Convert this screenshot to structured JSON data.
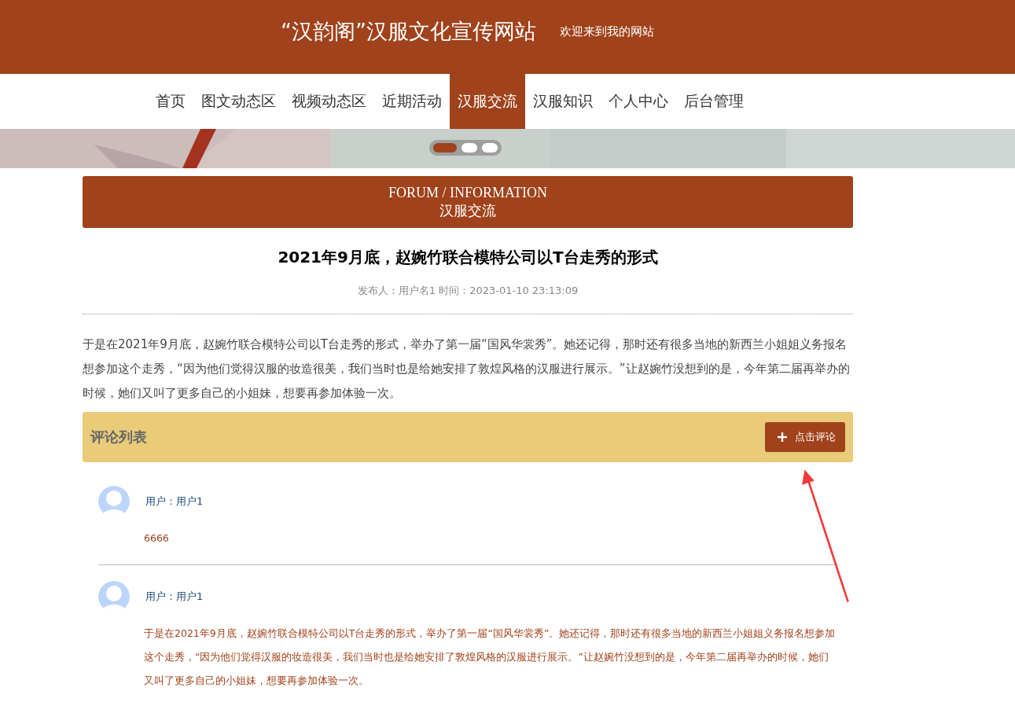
{
  "header": {
    "site_title": "“汉韵阁”汉服文化宣传网站",
    "welcome": "欢迎来到我的网站"
  },
  "nav": [
    {
      "label": "首页",
      "selected": false
    },
    {
      "label": "图文动态区",
      "selected": false
    },
    {
      "label": "视频动态区",
      "selected": false
    },
    {
      "label": "近期活动",
      "selected": false
    },
    {
      "label": "汉服交流",
      "selected": true
    },
    {
      "label": "汉服知识",
      "selected": false
    },
    {
      "label": "个人中心",
      "selected": false
    },
    {
      "label": "后台管理",
      "selected": false
    }
  ],
  "banner": {
    "kind": "picture",
    "dots": [
      {
        "selected": true
      },
      {
        "selected": false
      },
      {
        "selected": false
      }
    ]
  },
  "section_heading": {
    "english": "FORUM / INFORMATION",
    "chinese": "汉服交流"
  },
  "article": {
    "title": "2021年9月底，赵婉竹联合模特公司以T台走秀的形式",
    "meta": "发布人：用户名1 时间：2023-01-10 23:13:09",
    "body": "于是在2021年9月底，赵婉竹联合模特公司以T台走秀的形式，举办了第一届“国风华裳秀”。她还记得，那时还有很多当地的新西兰小姐姐义务报名想参加这个走秀，“因为他们觉得汉服的妆造很美，我们当时也是给她安排了敦煌风格的汉服进行展示。”让赵婉竹没想到的是，今年第二届再举办的时候，她们又叫了更多自己的小姐妹，想要再参加体验一次。"
  },
  "comments": {
    "title": "评论列表",
    "add_button": "点击评论",
    "items": [
      {
        "user": "用户：用户1",
        "text": "6666"
      },
      {
        "user": "用户：用户1",
        "text": "于是在2021年9月底，赵婉竹联合模特公司以T台走秀的形式，举办了第一届“国风华裳秀”。她还记得，那时还有很多当地的新西兰小姐姐义务报名想参加这个走秀，“因为他们觉得汉服的妆造很美，我们当时也是给她安排了敦煌风格的汉服进行展示。”让赵婉竹没想到的是，今年第二届再举办的时候，她们又叫了更多自己的小姐妹，想要再参加体验一次。"
      }
    ]
  }
}
